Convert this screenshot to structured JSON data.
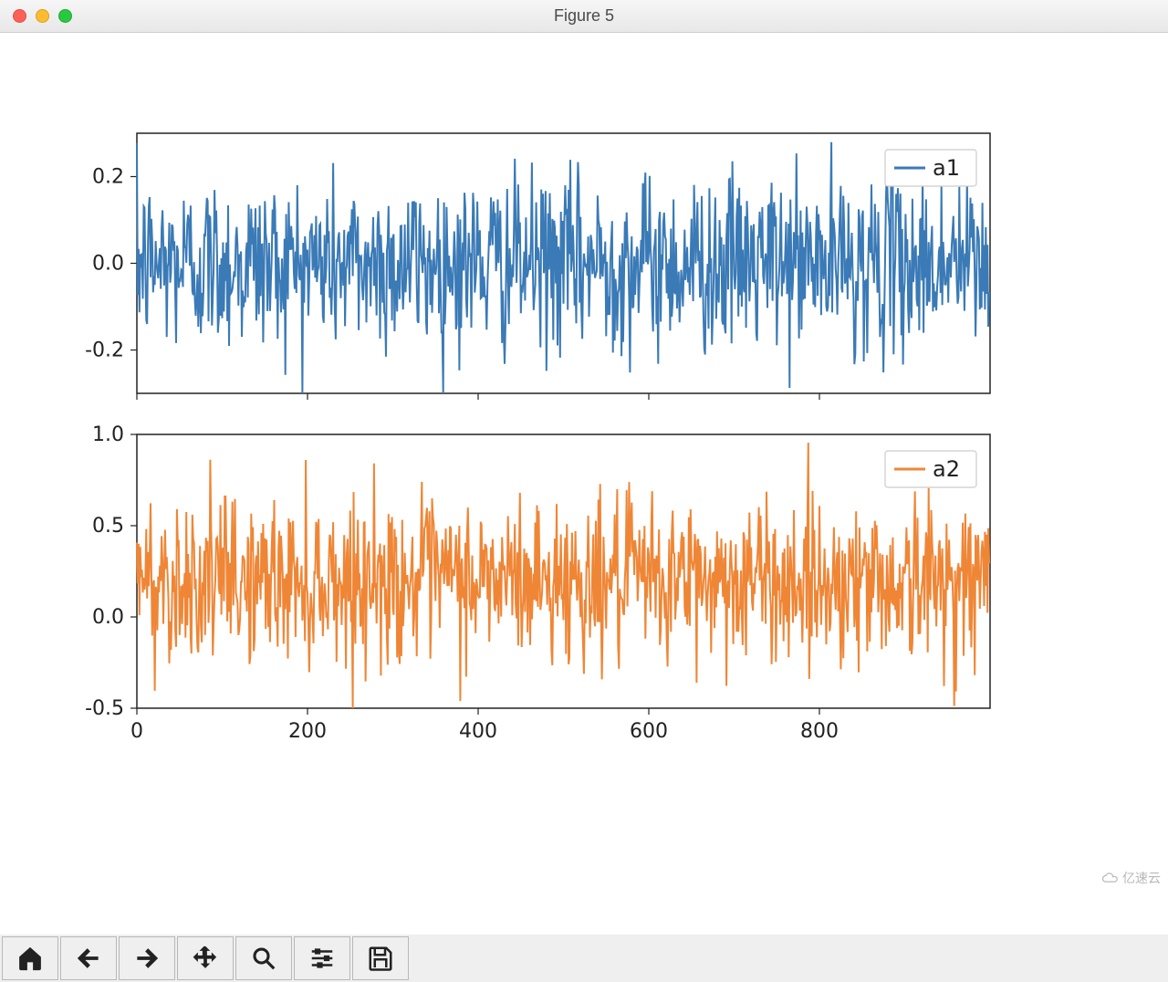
{
  "window": {
    "title": "Figure 5"
  },
  "toolbar_items": [
    "home",
    "back",
    "forward",
    "pan",
    "zoom",
    "configure",
    "save"
  ],
  "watermark": "亿速云",
  "colors": {
    "a1": "#3a7ab6",
    "a2": "#ef8636",
    "axis": "#222222",
    "grid": "none"
  },
  "chart_data": [
    {
      "type": "line",
      "series": [
        {
          "name": "a1",
          "color": "#3a7ab6",
          "description": "dense noise ~1000 samples centered near 0",
          "approx_mean": 0.0,
          "approx_std": 0.1
        }
      ],
      "xlim": [
        0,
        1000
      ],
      "ylim": [
        -0.3,
        0.3
      ],
      "yticks": [
        -0.2,
        0.0,
        0.2
      ],
      "xticks": [
        0,
        200,
        400,
        600,
        800
      ],
      "show_xtick_labels": false,
      "legend": {
        "labels": [
          "a1"
        ],
        "loc": "upper right"
      }
    },
    {
      "type": "line",
      "series": [
        {
          "name": "a2",
          "color": "#ef8636",
          "description": "dense noise ~1000 samples centered near 0.2",
          "approx_mean": 0.2,
          "approx_std": 0.22
        }
      ],
      "xlim": [
        0,
        1000
      ],
      "ylim": [
        -0.5,
        1.0
      ],
      "yticks": [
        -0.5,
        0.0,
        0.5,
        1.0
      ],
      "xticks": [
        0,
        200,
        400,
        600,
        800
      ],
      "show_xtick_labels": true,
      "legend": {
        "labels": [
          "a2"
        ],
        "loc": "upper right"
      }
    }
  ]
}
